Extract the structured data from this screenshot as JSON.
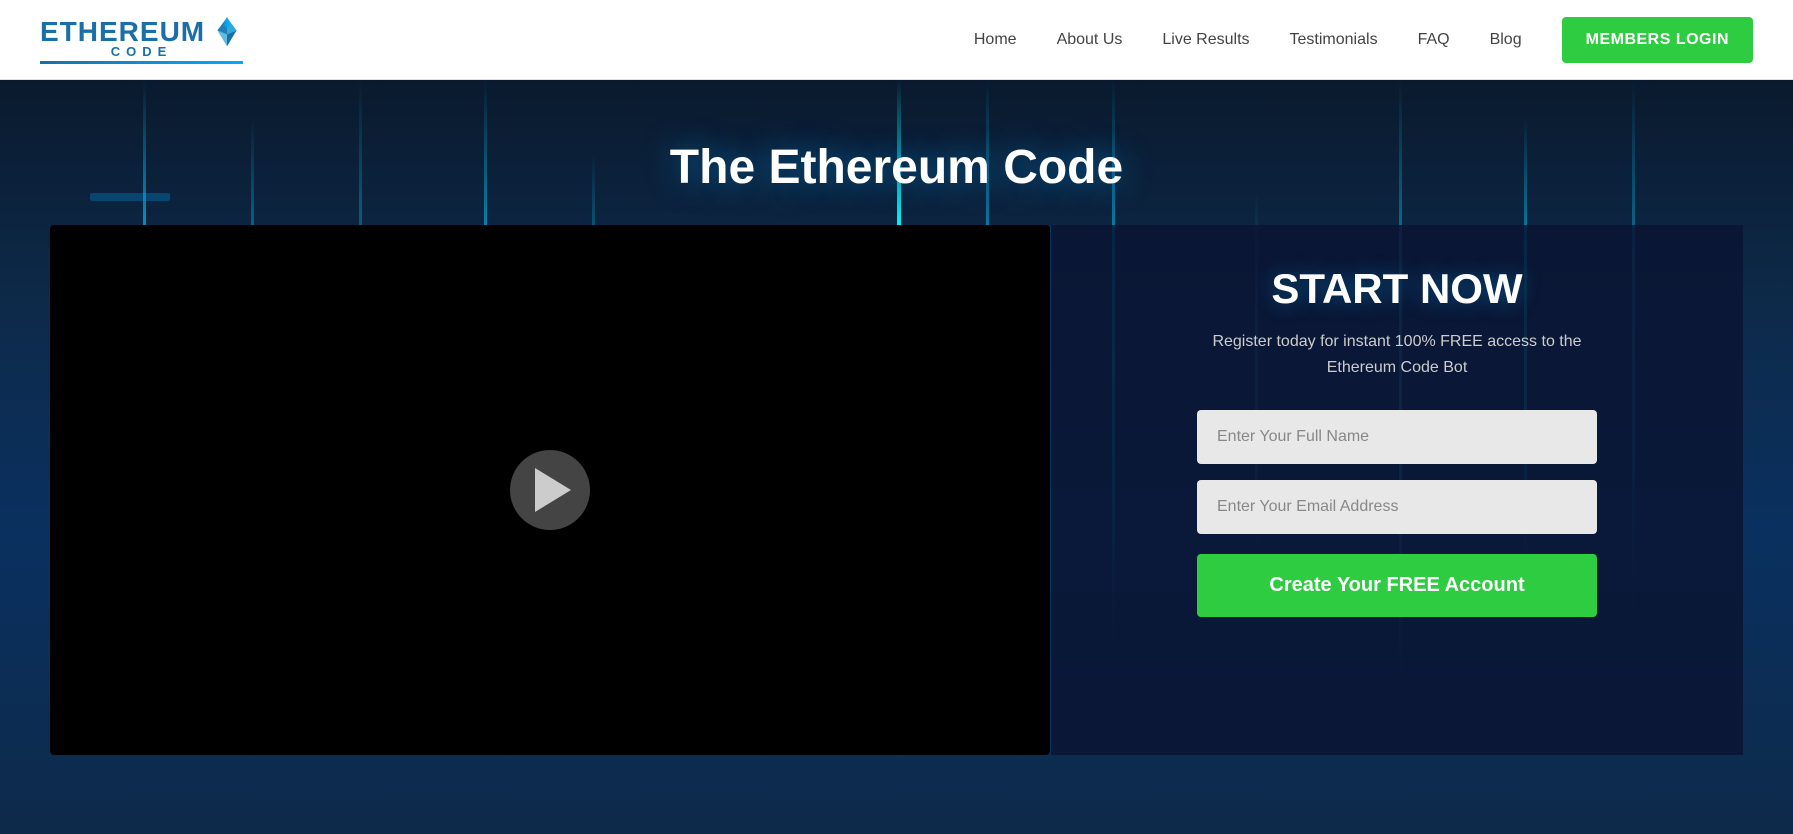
{
  "header": {
    "logo": {
      "ethereum_text": "ETHEREUM",
      "code_text": "CODE"
    },
    "nav": {
      "items": [
        {
          "label": "Home",
          "id": "home"
        },
        {
          "label": "About Us",
          "id": "about"
        },
        {
          "label": "Live Results",
          "id": "live-results"
        },
        {
          "label": "Testimonials",
          "id": "testimonials"
        },
        {
          "label": "FAQ",
          "id": "faq"
        },
        {
          "label": "Blog",
          "id": "blog"
        }
      ]
    },
    "members_btn_label": "MEMBERS LOGIN"
  },
  "hero": {
    "title": "The Ethereum Code",
    "signup": {
      "heading": "START NOW",
      "description": "Register today for instant 100% FREE access to the Ethereum Code Bot",
      "full_name_placeholder": "Enter Your Full Name",
      "email_placeholder": "Enter Your Email Address",
      "cta_button": "Create Your FREE Account"
    }
  }
}
